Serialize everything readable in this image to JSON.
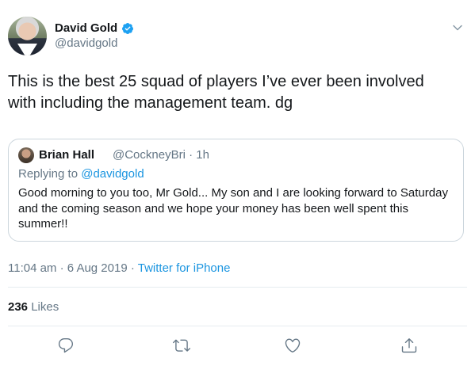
{
  "author": {
    "name": "David Gold",
    "handle": "@davidgold",
    "verified": true
  },
  "tweet": {
    "text": "This is the best 25 squad of players I’ve ever been involved with including the management team. dg"
  },
  "quoted": {
    "name": "Brian Hall",
    "handle_time": "@CockneyBri · 1h",
    "replying_prefix": "Replying to ",
    "replying_to": "@davidgold",
    "text": "Good morning to you too, Mr Gold... My son and I are looking forward to Saturday and the coming season and we hope your money has been well spent this summer!!"
  },
  "meta": {
    "timestamp": "11:04 am · 6 Aug 2019 · ",
    "source": "Twitter for iPhone"
  },
  "stats": {
    "likes_count": "236",
    "likes_label": " Likes"
  },
  "icons": {
    "verified": "verified-badge-icon",
    "menu": "chevron-down-icon",
    "reply": "reply-icon",
    "retweet": "retweet-icon",
    "like": "heart-icon",
    "share": "share-icon"
  },
  "colors": {
    "accent": "#1b95e0",
    "verified": "#1da1f2",
    "secondary_text": "#657786",
    "border": "#ccd6dd"
  }
}
